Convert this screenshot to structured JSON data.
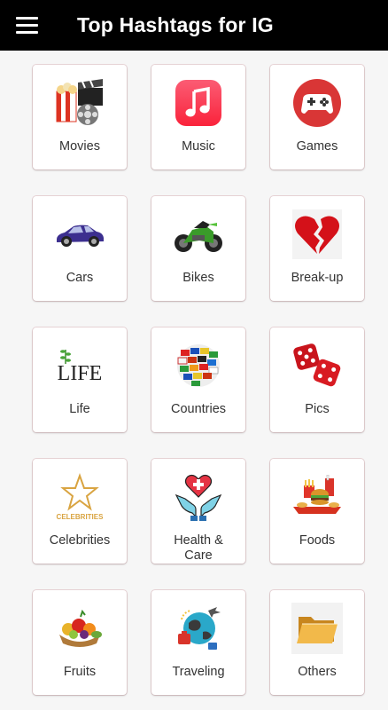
{
  "appbar": {
    "title": "Top Hashtags for IG"
  },
  "categories": [
    {
      "label": "Movies",
      "icon": "movie-clapper-popcorn-icon"
    },
    {
      "label": "Music",
      "icon": "music-note-icon"
    },
    {
      "label": "Games",
      "icon": "gamepad-icon"
    },
    {
      "label": "Cars",
      "icon": "car-icon"
    },
    {
      "label": "Bikes",
      "icon": "motorbike-icon"
    },
    {
      "label": "Break-up",
      "icon": "broken-heart-icon"
    },
    {
      "label": "Life",
      "icon": "life-logo-icon",
      "icon_text": "LIFE"
    },
    {
      "label": "Countries",
      "icon": "flags-globe-icon"
    },
    {
      "label": "Pics",
      "icon": "dice-icon"
    },
    {
      "label": "Celebrities",
      "icon": "celebrity-star-icon",
      "icon_text": "CELEBRITIES"
    },
    {
      "label": "Health &\nCare",
      "icon": "health-care-hands-icon"
    },
    {
      "label": "Foods",
      "icon": "fast-food-icon"
    },
    {
      "label": "Fruits",
      "icon": "fruit-basket-icon"
    },
    {
      "label": "Traveling",
      "icon": "travel-globe-icon"
    },
    {
      "label": "Others",
      "icon": "folder-icon"
    }
  ],
  "colors": {
    "appbar": "#000000",
    "background": "#f6f6f6",
    "card_border": "#ead6d8"
  }
}
